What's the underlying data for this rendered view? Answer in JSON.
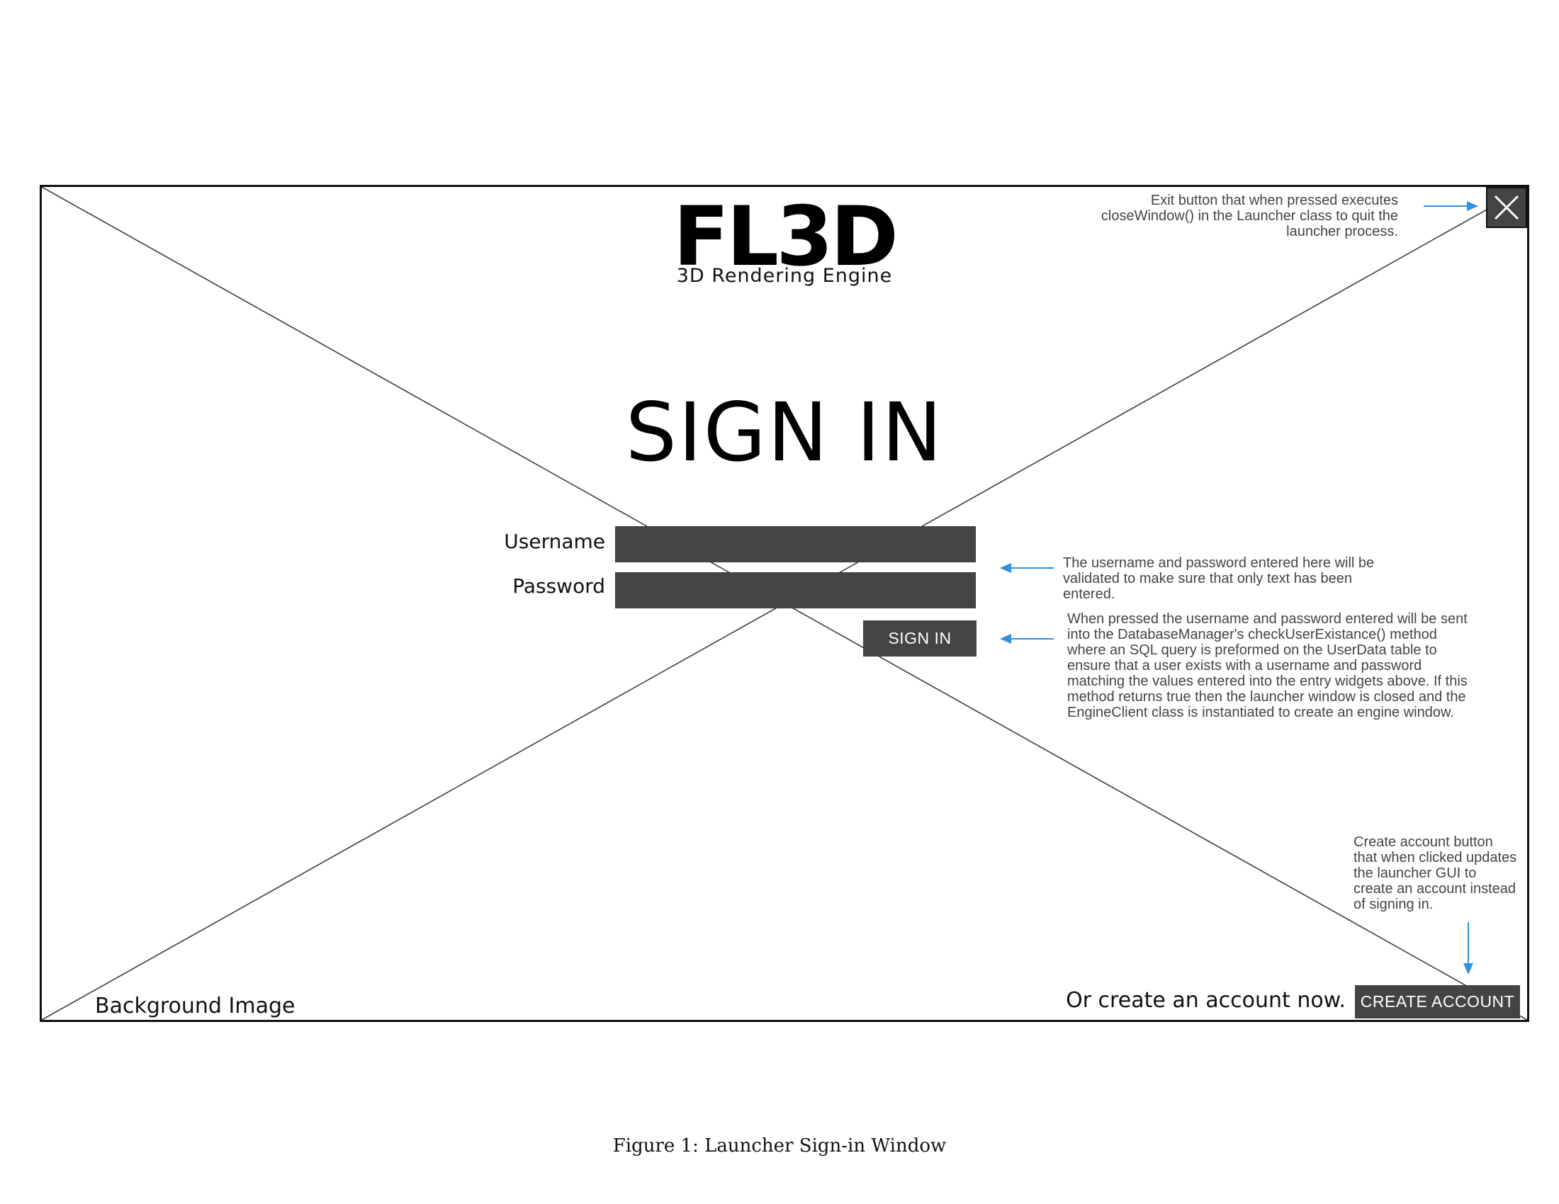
{
  "window": {
    "logo_title": "FL3D",
    "logo_subtitle": "3D Rendering Engine",
    "heading": "SIGN IN",
    "background_label": "Background Image"
  },
  "form": {
    "username_label": "Username",
    "password_label": "Password",
    "username_value": "",
    "password_value": "",
    "signin_label": "SIGN IN"
  },
  "footer": {
    "create_prompt": "Or create an account now.",
    "create_label": "CREATE ACCOUNT"
  },
  "close_button": {
    "icon": "close-icon"
  },
  "annotations": {
    "exit": "Exit button that when pressed executes closeWindow() in the Launcher class to quit the launcher process.",
    "fields": "The username and password entered here will be validated to make sure that only text has been entered.",
    "signin": "When pressed the username and password entered will be sent into the DatabaseManager's checkUserExistance() method where an SQL query is preformed on the UserData table to ensure that a user exists with a username and password matching the values entered into the entry widgets above. If this method returns true then the launcher window is closed and the EngineClient class is instantiated to create an engine window.",
    "create": "Create account button that when clicked updates the launcher GUI to create an account instead of signing in."
  },
  "caption": "Figure 1: Launcher Sign-in Window",
  "colors": {
    "widget": "#444444",
    "arrow": "#2f8fe0",
    "text": "#111111"
  }
}
